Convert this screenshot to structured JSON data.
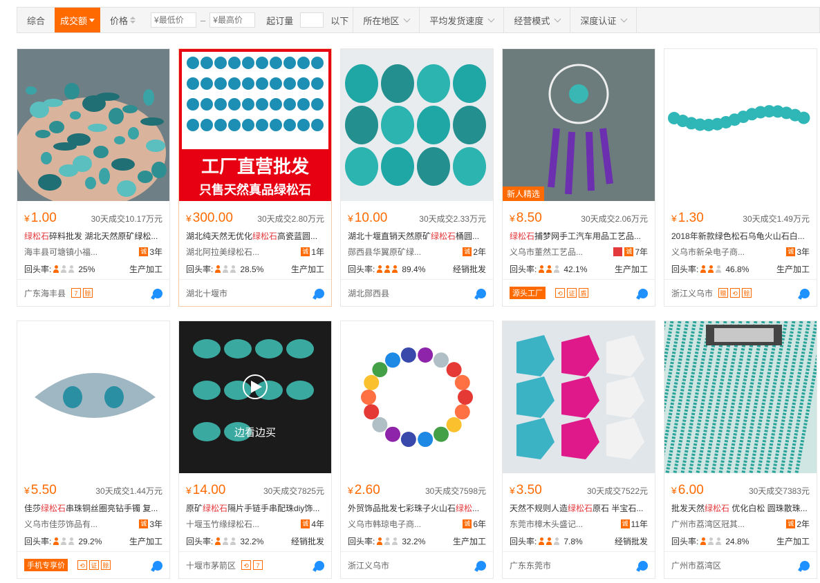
{
  "filters": {
    "comprehensive": "综合",
    "volume": "成交额",
    "price": "价格",
    "min_price_placeholder": "¥最低价",
    "max_price_placeholder": "¥最高价",
    "dash": "–",
    "moq_label": "起订量",
    "moq_suffix": "以下",
    "region": "所在地区",
    "shipping_speed": "平均发货速度",
    "business_mode": "经营模式",
    "certification": "深度认证"
  },
  "colors": {
    "accent": "#ff6a00",
    "keyword": "#e4393c",
    "chat": "#1e90ff"
  },
  "products": [
    {
      "price": "1.00",
      "sold": "30天成交10.17万元",
      "title_pre": "",
      "kw": "绿松石",
      "title_post": "碎料批发 湖北天然原矿绿松...",
      "company": "海丰县可塘镇小福...",
      "years": "3年",
      "repeat_label": "回头率:",
      "repeat": "25%",
      "people_on": 1,
      "mode": "生产加工",
      "location": "广东海丰县",
      "badges": [
        "7",
        "赊"
      ],
      "promo": ""
    },
    {
      "price": "300.00",
      "sold": "30天成交2.80万元",
      "title_pre": "湖北纯天然无优化",
      "kw": "绿松石",
      "title_post": "高瓷蓝圆...",
      "company": "湖北阿拉美绿松石...",
      "years": "1年",
      "repeat_label": "回头率:",
      "repeat": "28.5%",
      "people_on": 1,
      "mode": "生产加工",
      "location": "湖北十堰市",
      "badges": [],
      "promo": "",
      "cover_line1": "工厂直营批发",
      "cover_line2": "只售天然真品绿松石"
    },
    {
      "price": "10.00",
      "sold": "30天成交2.33万元",
      "title_pre": "湖北十堰直销天然原矿",
      "kw": "绿松石",
      "title_post": "桶圆...",
      "company": "郧西县华翼原矿绿...",
      "years": "2年",
      "repeat_label": "回头率:",
      "repeat": "89.4%",
      "people_on": 3,
      "mode": "经销批发",
      "location": "湖北郧西县",
      "badges": [],
      "promo": ""
    },
    {
      "price": "8.50",
      "sold": "30天成交2.06万元",
      "title_pre": "",
      "kw": "绿松石",
      "title_post": "捕梦网手工汽车用品工艺品...",
      "company": "义乌市董然工艺品...",
      "years": "7年",
      "repeat_label": "回头率:",
      "repeat": "42.1%",
      "people_on": 2,
      "mode": "生产加工",
      "location": "",
      "badges": [
        "⟲",
        "证",
        "盾"
      ],
      "promo": "源头工厂",
      "new_tag": "新人精选"
    },
    {
      "price": "1.30",
      "sold": "30天成交1.49万元",
      "title_pre": "2018年新款绿色松石乌龟火山石白...",
      "kw": "",
      "title_post": "",
      "company": "义乌市新朵电子商...",
      "years": "3年",
      "repeat_label": "回头率:",
      "repeat": "46.8%",
      "people_on": 2,
      "mode": "生产加工",
      "location": "浙江义乌市",
      "badges": [
        "赠",
        "⟲",
        "赊"
      ],
      "promo": ""
    },
    {
      "price": "5.50",
      "sold": "30天成交1.44万元",
      "title_pre": "佳莎",
      "kw": "绿松石",
      "title_post": "串珠铜丝圈亮钻手镯 复...",
      "company": "义乌市佳莎饰品有...",
      "years": "3年",
      "repeat_label": "回头率:",
      "repeat": "29.2%",
      "people_on": 1,
      "mode": "生产加工",
      "location": "",
      "badges": [
        "⟲",
        "证",
        "赊"
      ],
      "promo": "手机专享价"
    },
    {
      "price": "14.00",
      "sold": "30天成交7825元",
      "title_pre": "原矿",
      "kw": "绿松石",
      "title_post": "隔片手链手串配珠diy饰...",
      "company": "十堰玉竹缘绿松石...",
      "years": "4年",
      "repeat_label": "回头率:",
      "repeat": "32.2%",
      "people_on": 1,
      "mode": "经销批发",
      "location": "十堰市茅箭区",
      "badges": [
        "⟲",
        "7"
      ],
      "promo": "",
      "cover_line1": "边看边买"
    },
    {
      "price": "2.60",
      "sold": "30天成交7598元",
      "title_pre": "外贸饰品批发七彩珠子火山石",
      "kw": "绿松",
      "title_post": "...",
      "company": "义乌市韩琼电子商...",
      "years": "6年",
      "repeat_label": "回头率:",
      "repeat": "32.2%",
      "people_on": 1,
      "mode": "生产加工",
      "location": "浙江义乌市",
      "badges": [],
      "promo": ""
    },
    {
      "price": "3.50",
      "sold": "30天成交7522元",
      "title_pre": "天然不规则人造",
      "kw": "绿松石",
      "title_post": "原石 半宝石...",
      "company": "东莞市樟木头盛记...",
      "years": "11年",
      "repeat_label": "回头率:",
      "repeat": "7.8%",
      "people_on": 2,
      "mode": "经销批发",
      "location": "广东东莞市",
      "badges": [],
      "promo": ""
    },
    {
      "price": "6.00",
      "sold": "30天成交7383元",
      "title_pre": "批发天然",
      "kw": "绿松石",
      "title_post": " 优化白松 圆珠散珠...",
      "company": "广州市荔湾区冠其...",
      "years": "2年",
      "repeat_label": "回头率:",
      "repeat": "24.8%",
      "people_on": 1,
      "mode": "生产加工",
      "location": "广州市荔湾区",
      "badges": [],
      "promo": ""
    }
  ]
}
